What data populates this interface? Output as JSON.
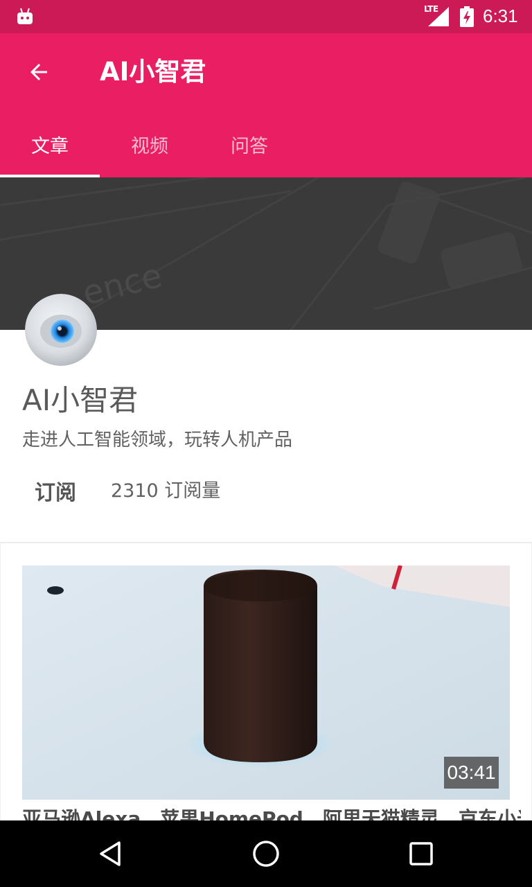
{
  "status_bar": {
    "network": "LTE",
    "time": "6:31",
    "icons": [
      "android-notification-icon",
      "lte-signal-icon",
      "battery-charging-icon"
    ]
  },
  "app_bar": {
    "title": "AI小智君",
    "back_icon": "arrow-back-icon",
    "background": "#e91e63"
  },
  "tabs": [
    {
      "label": "文章",
      "active": true
    },
    {
      "label": "视频",
      "active": false
    },
    {
      "label": "问答",
      "active": false
    }
  ],
  "profile": {
    "name": "AI小智君",
    "description": "走进人工智能领域，玩转人机产品",
    "subscribe_label": "订阅",
    "subscriber_count": "2310 订阅量"
  },
  "article": {
    "duration": "03:41",
    "title": "亚马逊Alexa，苹果HomePod，阿里天猫精灵，京东小米"
  },
  "nav_bar": {
    "icons": [
      "back-triangle-icon",
      "home-circle-icon",
      "recents-square-icon"
    ]
  }
}
